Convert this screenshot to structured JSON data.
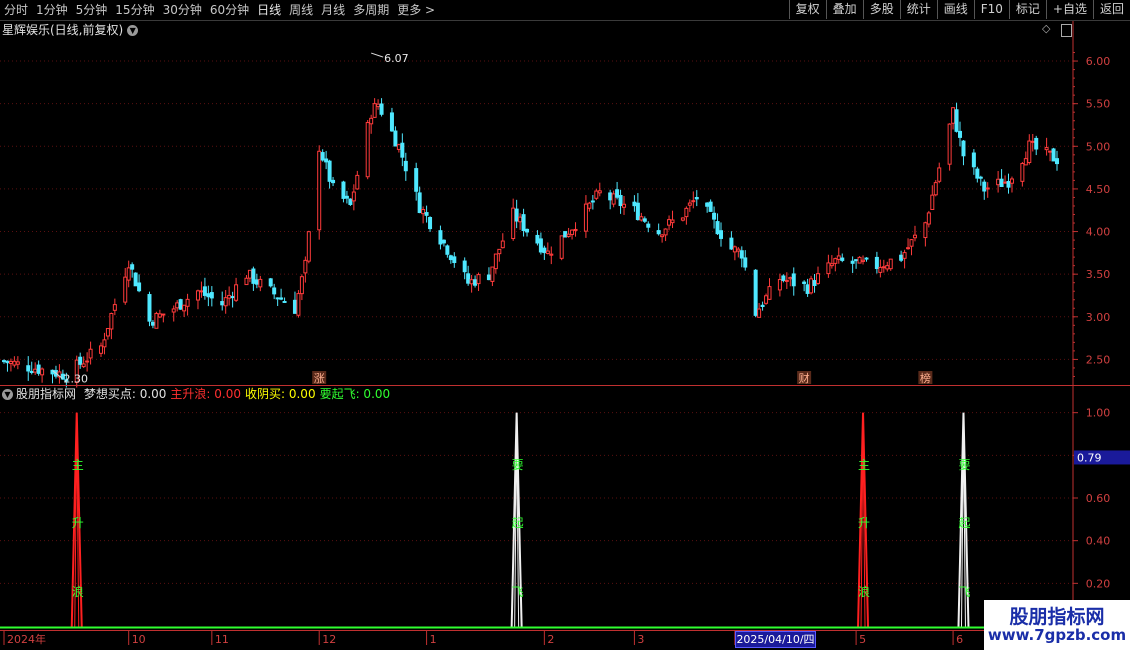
{
  "toolbar": {
    "periods": [
      "分时",
      "1分钟",
      "5分钟",
      "15分钟",
      "30分钟",
      "60分钟",
      "日线",
      "周线",
      "月线",
      "多周期",
      "更多 >"
    ],
    "active_period": "日线",
    "tools": [
      "复权",
      "叠加",
      "多股",
      "统计",
      "画线",
      "F10",
      "标记",
      "+自选",
      "返回"
    ]
  },
  "chart_title": "星辉娱乐(日线,前复权)",
  "indicator": {
    "name": "股朋指标网",
    "items": [
      {
        "label": "梦想买点:",
        "value": "0.00",
        "color": "#e0e0e0"
      },
      {
        "label": "主升浪:",
        "value": "0.00",
        "color": "#ff3030"
      },
      {
        "label": "收阴买:",
        "value": "0.00",
        "color": "#ffff00"
      },
      {
        "label": "要起飞:",
        "value": "0.00",
        "color": "#30ff30"
      }
    ],
    "cursor_value": "0.79"
  },
  "colors": {
    "up": "#ff3b3b",
    "down": "#4fe8ff",
    "axis": "#c03030",
    "green": "#30ff30"
  },
  "chart_data": [
    {
      "type": "candlestick",
      "title": "星辉娱乐(日线,前复权)",
      "ylim": [
        2.2,
        6.2
      ],
      "y_ticks": [
        "2.50",
        "3.00",
        "3.50",
        "4.00",
        "4.50",
        "5.00",
        "5.50",
        "6.00"
      ],
      "high_annotation": "6.07",
      "low_annotation": "2.30",
      "event_markers": [
        {
          "text": "涨",
          "date": "2024-12-02"
        },
        {
          "text": "财",
          "date": "2025-04-21"
        },
        {
          "text": "榜",
          "date": "2025-05-26"
        }
      ],
      "x_labels": [
        "2024年",
        "10",
        "11",
        "12",
        "1",
        "2",
        "3",
        "4",
        "5",
        "6"
      ],
      "x_label_dates": [
        "2024-09-02",
        "2024-10-08",
        "2024-11-01",
        "2024-12-02",
        "2025-01-02",
        "2025-02-05",
        "2025-03-03",
        "2025-04-01",
        "2025-05-06",
        "2025-06-03"
      ],
      "cursor_date": "2025/04/10/四",
      "anchors": [
        {
          "d": "2024-09-02",
          "c": 2.48
        },
        {
          "d": "2024-09-13",
          "c": 2.38
        },
        {
          "d": "2024-09-20",
          "c": 2.32
        },
        {
          "d": "2024-09-30",
          "c": 2.65
        },
        {
          "d": "2024-10-08",
          "c": 3.65
        },
        {
          "d": "2024-10-14",
          "c": 2.95
        },
        {
          "d": "2024-10-21",
          "c": 3.1
        },
        {
          "d": "2024-10-28",
          "c": 3.3
        },
        {
          "d": "2024-11-04",
          "c": 3.15
        },
        {
          "d": "2024-11-11",
          "c": 3.5
        },
        {
          "d": "2024-11-18",
          "c": 3.3
        },
        {
          "d": "2024-11-25",
          "c": 3.1
        },
        {
          "d": "2024-11-28",
          "c": 3.6
        },
        {
          "d": "2024-12-02",
          "c": 5.0
        },
        {
          "d": "2024-12-06",
          "c": 4.5
        },
        {
          "d": "2024-12-11",
          "c": 4.3
        },
        {
          "d": "2024-12-17",
          "c": 5.4
        },
        {
          "d": "2024-12-19",
          "c": 5.5
        },
        {
          "d": "2024-12-25",
          "c": 5.0
        },
        {
          "d": "2024-12-31",
          "c": 4.3
        },
        {
          "d": "2025-01-08",
          "c": 3.8
        },
        {
          "d": "2025-01-14",
          "c": 3.4
        },
        {
          "d": "2025-01-20",
          "c": 3.5
        },
        {
          "d": "2025-01-27",
          "c": 4.2
        },
        {
          "d": "2025-02-06",
          "c": 3.75
        },
        {
          "d": "2025-02-14",
          "c": 4.1
        },
        {
          "d": "2025-02-21",
          "c": 4.45
        },
        {
          "d": "2025-03-03",
          "c": 4.25
        },
        {
          "d": "2025-03-10",
          "c": 4.0
        },
        {
          "d": "2025-03-17",
          "c": 4.2
        },
        {
          "d": "2025-03-21",
          "c": 4.4
        },
        {
          "d": "2025-03-31",
          "c": 3.8
        },
        {
          "d": "2025-04-03",
          "c": 3.75
        },
        {
          "d": "2025-04-07",
          "c": 3.05
        },
        {
          "d": "2025-04-14",
          "c": 3.45
        },
        {
          "d": "2025-04-22",
          "c": 3.35
        },
        {
          "d": "2025-04-30",
          "c": 3.65
        },
        {
          "d": "2025-05-12",
          "c": 3.6
        },
        {
          "d": "2025-05-19",
          "c": 3.7
        },
        {
          "d": "2025-05-26",
          "c": 4.1
        },
        {
          "d": "2025-06-03",
          "c": 5.4
        },
        {
          "d": "2025-06-06",
          "c": 4.9
        },
        {
          "d": "2025-06-12",
          "c": 4.5
        },
        {
          "d": "2025-06-19",
          "c": 4.6
        },
        {
          "d": "2025-06-25",
          "c": 5.0
        },
        {
          "d": "2025-07-03",
          "c": 4.85
        }
      ]
    },
    {
      "type": "line",
      "title": "股朋指标网",
      "ylim": [
        0,
        1.05
      ],
      "y_ticks": [
        "0.20",
        "0.40",
        "0.60",
        "1.00"
      ],
      "spikes": [
        {
          "date": "2024-09-23",
          "color": "#ff2020",
          "labels": [
            "主",
            "升",
            "浪"
          ]
        },
        {
          "date": "2025-01-28",
          "color": "#f0f0f0",
          "labels": [
            "要",
            "起",
            "飞"
          ]
        },
        {
          "date": "2025-05-08",
          "color": "#ff2020",
          "labels": [
            "主",
            "升",
            "浪"
          ]
        },
        {
          "date": "2025-06-06",
          "color": "#f0f0f0",
          "labels": [
            "要",
            "起",
            "飞"
          ]
        }
      ]
    }
  ]
}
